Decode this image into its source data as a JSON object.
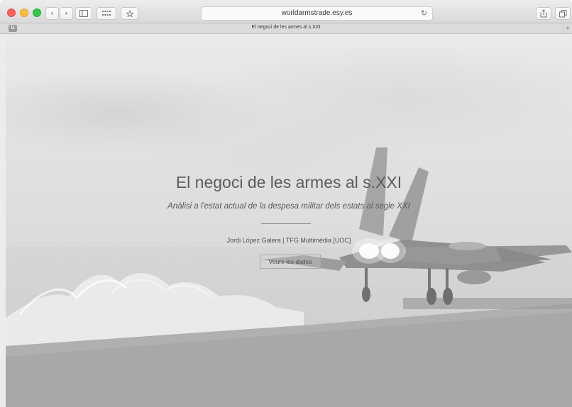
{
  "browser": {
    "url": "worldarmstrade.esy.es",
    "tab_title": "El negoci de les armes al s.XXI",
    "tab_favicon_letter": "U",
    "icons": [
      "back-icon",
      "forward-icon",
      "sidebar-icon",
      "top-sites-icon",
      "bookmark-icon",
      "reload-icon",
      "share-icon",
      "tabs-overview-icon",
      "new-tab-icon"
    ]
  },
  "hero": {
    "title": "El negoci de les armes al s.XXI",
    "subtitle": "Anàlisi a l'estat actual de la despesa militar dels estats al segle XXI",
    "author": "Jordi López Galera | TFG Multimèdia [UOC]",
    "cta_label": "Veure les dades"
  },
  "colors": {
    "red": "#fc605c",
    "yellow": "#fdbc40",
    "green": "#34c84a"
  }
}
